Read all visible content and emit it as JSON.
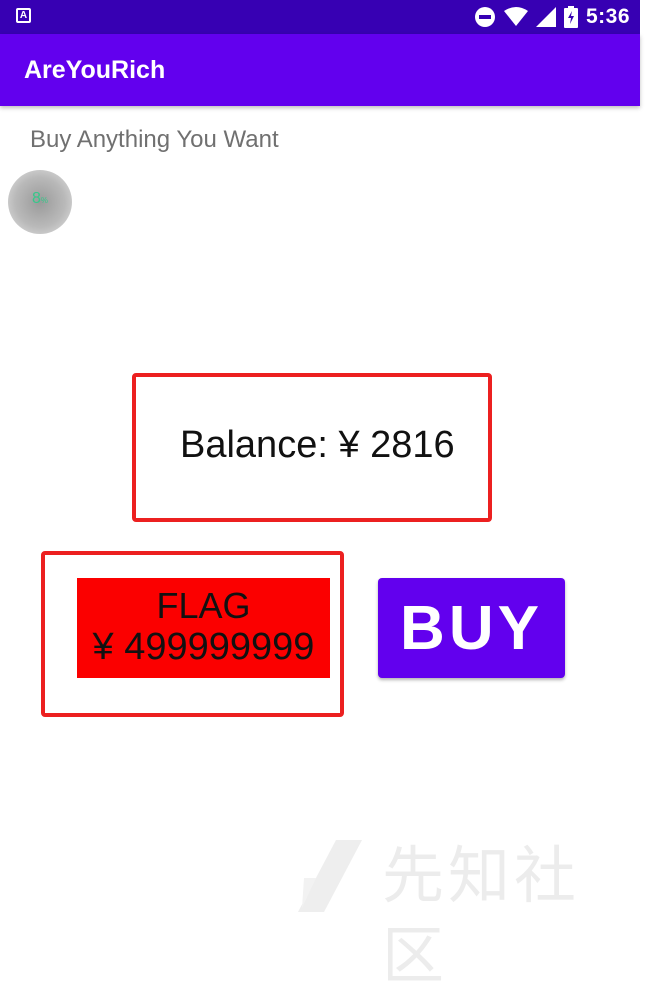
{
  "status_bar": {
    "time": "5:36",
    "icons": [
      "notification-a-icon",
      "do-not-disturb-icon",
      "wifi-icon",
      "signal-icon",
      "battery-icon"
    ]
  },
  "app_bar": {
    "title": "AreYouRich"
  },
  "main": {
    "subtitle": "Buy Anything You Want",
    "progress_value": 8,
    "progress_text": "8",
    "progress_unit": "%",
    "balance_text": "Balance: ¥ 2816",
    "item": {
      "name": "FLAG",
      "price": "¥ 499999999"
    },
    "buy_label": "BUY"
  },
  "watermark": {
    "text": "先知社区"
  },
  "colors": {
    "status_bar": "#3700b3",
    "primary": "#6200ee",
    "item_bg": "#fb0000",
    "highlight_border": "#ec2020",
    "progress_text": "#36c88a"
  }
}
